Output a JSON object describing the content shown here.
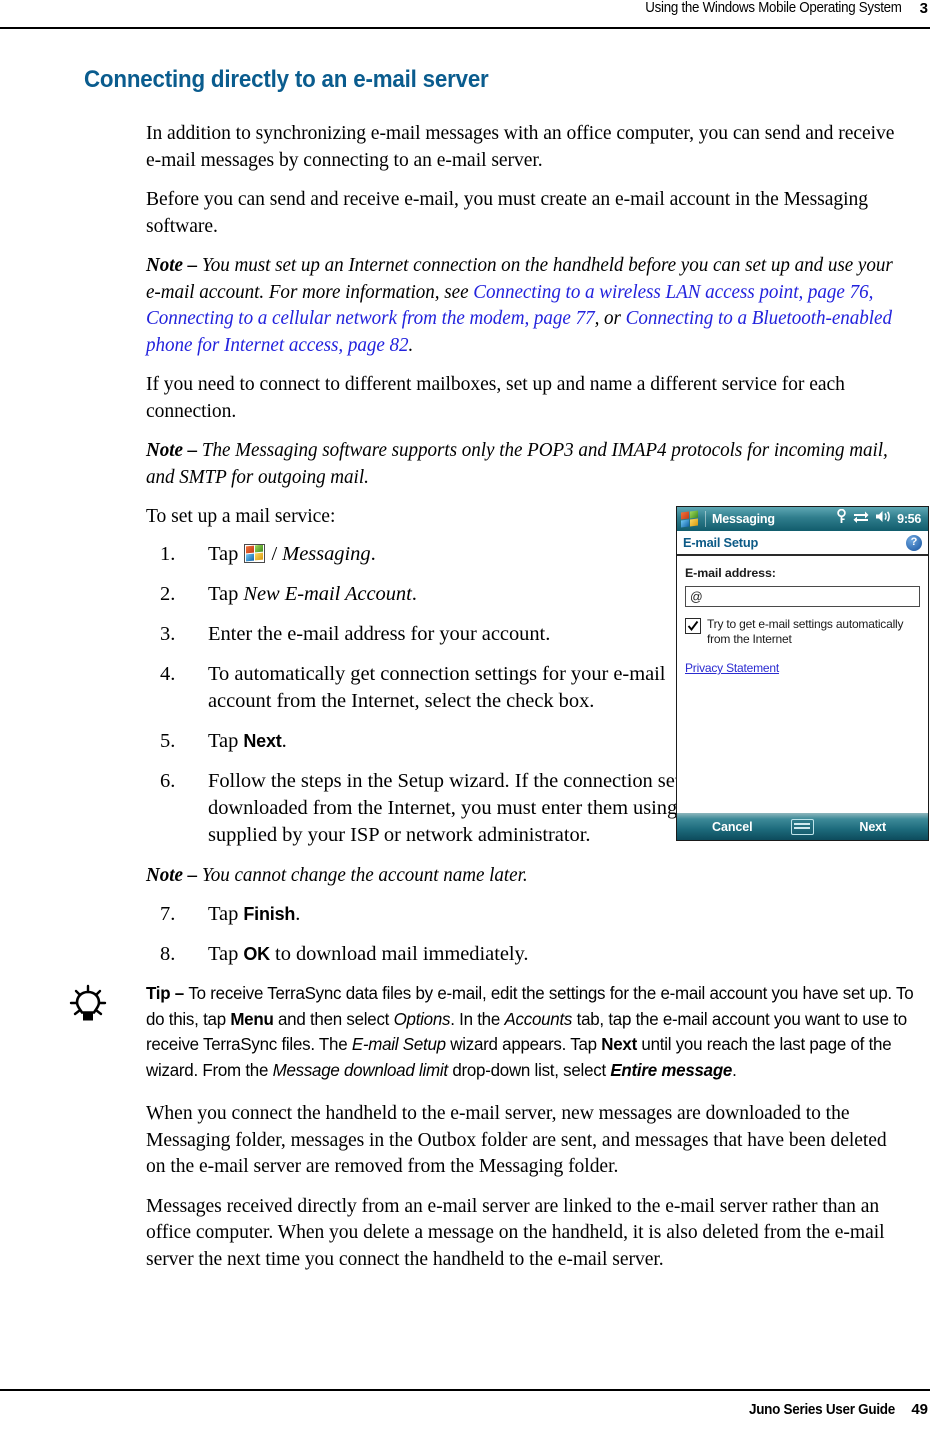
{
  "header": {
    "title": "Using the Windows Mobile Operating System",
    "chapter_number": "3"
  },
  "heading": "Connecting directly to an e-mail server",
  "paragraphs": {
    "intro": "In addition to synchronizing e-mail messages with an office computer, you can send and receive e-mail messages by connecting to an e-mail server.",
    "before": "Before you can send and receive e-mail, you must create an  e-mail account in the Messaging software.",
    "mailboxes": " If you need to connect to different mailboxes, set up and name a different service for each connection.",
    "to_set_up": "To set up a mail service:",
    "when_connect": "When you connect the handheld to the e-mail server, new messages are downloaded to the Messaging folder, messages in the Outbox folder are sent, and messages that have been deleted on the e-mail server are removed from the Messaging folder.",
    "messages_received": "Messages received directly from an e-mail server are linked to the e-mail server rather than an office computer. When you delete a message on the handheld, it is also deleted from the e-mail server the next time you connect the handheld to the e-mail server."
  },
  "notes": {
    "lead": "Note – ",
    "note1": {
      "text_a": "You must set up an Internet connection on the handheld before you can set up and use your e-mail account. For more information, see ",
      "link1": "Connecting to a wireless LAN access point, page 76",
      "sep1": ", ",
      "link2": "Connecting to a cellular network from the modem, page 77",
      "sep2": ", or ",
      "link3": "Connecting to a Bluetooth-enabled phone for Internet access, page 82",
      "end": "."
    },
    "note2": "The Messaging software supports only the POP3 and IMAP4 protocols for incoming mail, and SMTP for outgoing mail.",
    "note3": "You cannot change the account name later."
  },
  "steps": [
    {
      "num": "1.",
      "pre": "Tap ",
      "icon": "windows-start-icon",
      "post_plain": " / ",
      "post_italic": "Messaging",
      "tail": "."
    },
    {
      "num": "2.",
      "pre": "Tap ",
      "post_italic": "New E-mail Account",
      "tail": "."
    },
    {
      "num": "3.",
      "pre": "Enter the e-mail address for your account."
    },
    {
      "num": "4.",
      "pre": "To automatically get connection settings for your e-mail account from the Internet, select the check box."
    },
    {
      "num": "5.",
      "pre": "Tap ",
      "ui": "Next",
      "tail": "."
    },
    {
      "num": "6.",
      "pre": "Follow the steps in the Setup wizard. If the connection settings are not automatically downloaded from the Internet, you must enter them using the connection details supplied by your ISP or network administrator."
    },
    {
      "num": "7.",
      "pre": "Tap ",
      "ui": "Finish",
      "tail": "."
    },
    {
      "num": "8.",
      "pre": "Tap ",
      "ui": "OK",
      "tail": " to download mail immediately."
    }
  ],
  "tip": {
    "icon": "lightbulb-icon",
    "lead": "Tip – ",
    "t1": "To receive TerraSync data files by e-mail, edit the settings for the e-mail account you have set up. To do this, tap ",
    "b1": "Menu",
    "t2": " and then select ",
    "i1": "Options",
    "t3": ". In the ",
    "i2": "Accounts",
    "t4": " tab, tap the e-mail account you want to use to receive TerraSync files. The ",
    "i3": "E-mail Setup",
    "t5": " wizard appears. Tap ",
    "b2": "Next",
    "t6": " until you reach the last page of the wizard. From the ",
    "i4": "Message download limit",
    "t7": " drop-down list, select ",
    "bi1": "Entire message",
    "t8": "."
  },
  "device": {
    "app_title": "Messaging",
    "clock": "9:56",
    "status_icons": [
      "key-icon",
      "sync-icon",
      "volume-icon"
    ],
    "screen_title": "E-mail Setup",
    "help_label": "?",
    "field_label": "E-mail address:",
    "field_value": "@",
    "checkbox_checked": true,
    "checkbox_label": "Try to get e-mail settings automatically from the Internet",
    "privacy_link": "Privacy Statement",
    "softkey_left": "Cancel",
    "softkey_center_icon": "keyboard-icon",
    "softkey_right": "Next"
  },
  "footer": {
    "title": "Juno Series User Guide",
    "page_number": "49"
  },
  "colors": {
    "heading_blue": "#0a5c8e",
    "xref_blue": "#2222dd",
    "device_title_teal": "#2f7d8c",
    "device_screen_title": "#0c5a86"
  }
}
